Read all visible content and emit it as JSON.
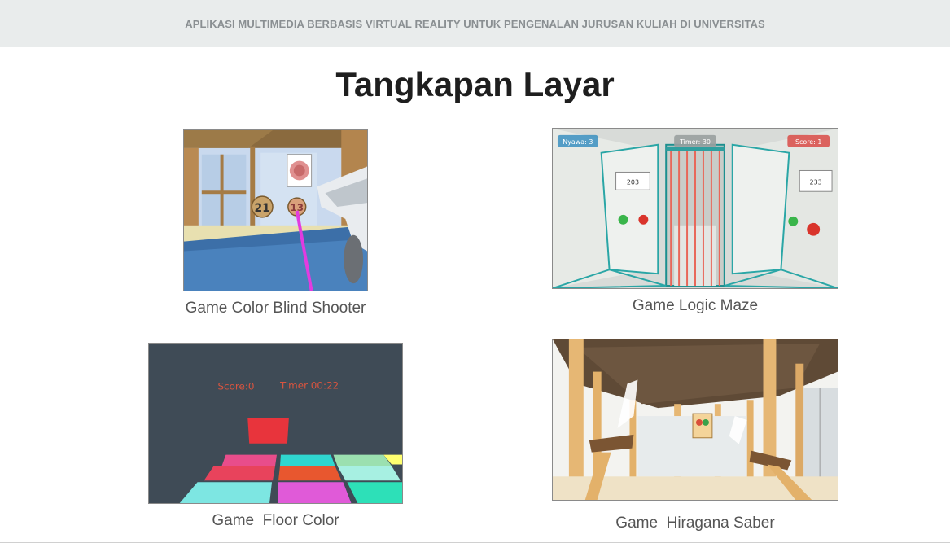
{
  "header": {
    "title": "APLIKASI MULTIMEDIA BERBASIS VIRTUAL REALITY UNTUK PENGENALAN JURUSAN KULIAH DI UNIVERSITAS"
  },
  "section": {
    "title": "Tangkapan Layar"
  },
  "screenshots": [
    {
      "caption": "Game Color Blind Shooter",
      "image_text": {
        "target_left": "21",
        "target_right": "13"
      }
    },
    {
      "caption": "Game Logic Maze",
      "image_text": {
        "hud_left": "Nyawa: 3",
        "hud_center": "Timer: 30",
        "hud_right": "Score: 1",
        "door_left": "203",
        "door_right": "233"
      }
    },
    {
      "caption": "Game  Floor Color",
      "image_text": {
        "score": "Score:0",
        "timer": "Timer 00:22"
      }
    },
    {
      "caption": "Game  Hiragana Saber"
    }
  ]
}
